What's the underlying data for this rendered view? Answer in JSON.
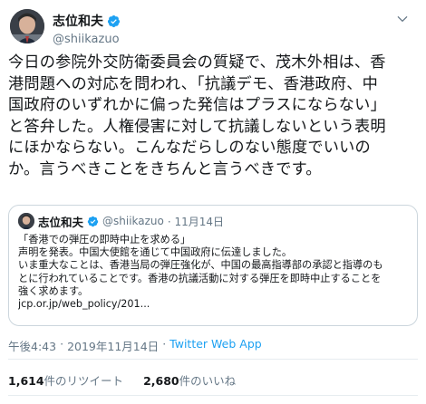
{
  "tweet": {
    "author": {
      "name": "志位和夫",
      "handle": "@shiikazuo"
    },
    "body_lines": [
      "今日の参院外交防衛委員会の質疑で、茂木外相は、香",
      "港問題への対応を問われ、「抗議デモ、香港政府、中",
      "国政府のいずれかに偏った発信はプラスにならない」",
      "と答弁した。人権侵害に対して抗議しないという表明",
      "にほかならない。こんなだらしのない態度でいいの",
      "か。言うべきことをきちんと言うべきです。"
    ],
    "quote": {
      "name": "志位和夫",
      "handle": "@shiikazuo",
      "date": "· 11月14日",
      "lines": [
        "「香港での弾圧の即時中止を求める」",
        "声明を発表。中国大使館を通じて中国政府に伝達しました。",
        "いま重大なことは、香港当局の弾圧強化が、中国の最高指導部の承認と指導のも",
        "とに行われていることです。香港の抗議活動に対する弾圧を即時中止することを",
        "強く求めます。",
        "jcp.or.jp/web_policy/201..."
      ]
    },
    "meta": {
      "time": "午後4:43",
      "separator1": "·",
      "date": "2019年11月14日",
      "separator2": "·",
      "source": "Twitter Web App"
    },
    "stats": {
      "retweets_count": "1,614",
      "retweets_label": "件のリツイート",
      "likes_count": "2,680",
      "likes_label": "件のいいね"
    }
  },
  "colors": {
    "text": "#14171a",
    "secondary": "#657786",
    "accent": "#1da1f2",
    "border": "#ccd6dd"
  },
  "icons": [
    "verified-badge-icon",
    "chevron-down-icon"
  ]
}
